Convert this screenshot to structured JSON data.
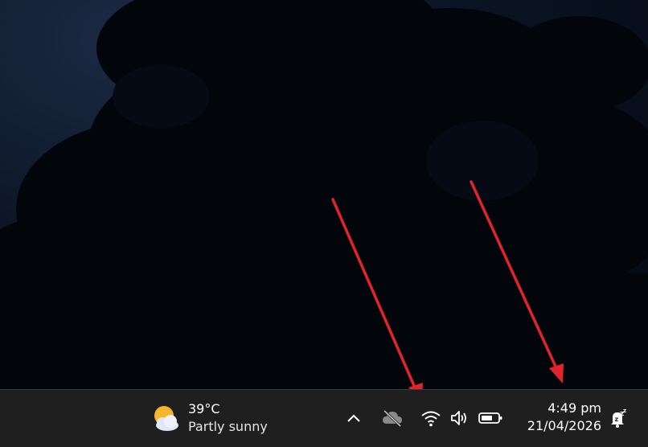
{
  "weather": {
    "temperature": "39°C",
    "condition": "Partly sunny",
    "icon": "partly-sunny-icon"
  },
  "tray": {
    "show_hidden_icon": "chevron-up-icon",
    "onedrive_icon": "cloud-offline-icon",
    "wifi_icon": "wifi-icon",
    "volume_icon": "speaker-icon",
    "battery_icon": "battery-icon"
  },
  "clock": {
    "time": "4:49 pm",
    "date": "21/04/2026"
  },
  "notifications": {
    "icon": "bell-do-not-disturb-icon"
  },
  "colors": {
    "taskbar": "#1f1f1f",
    "annotation_arrow": "#e0242b",
    "sun": "#f5b62e",
    "cloud": "#dfe8f5"
  }
}
